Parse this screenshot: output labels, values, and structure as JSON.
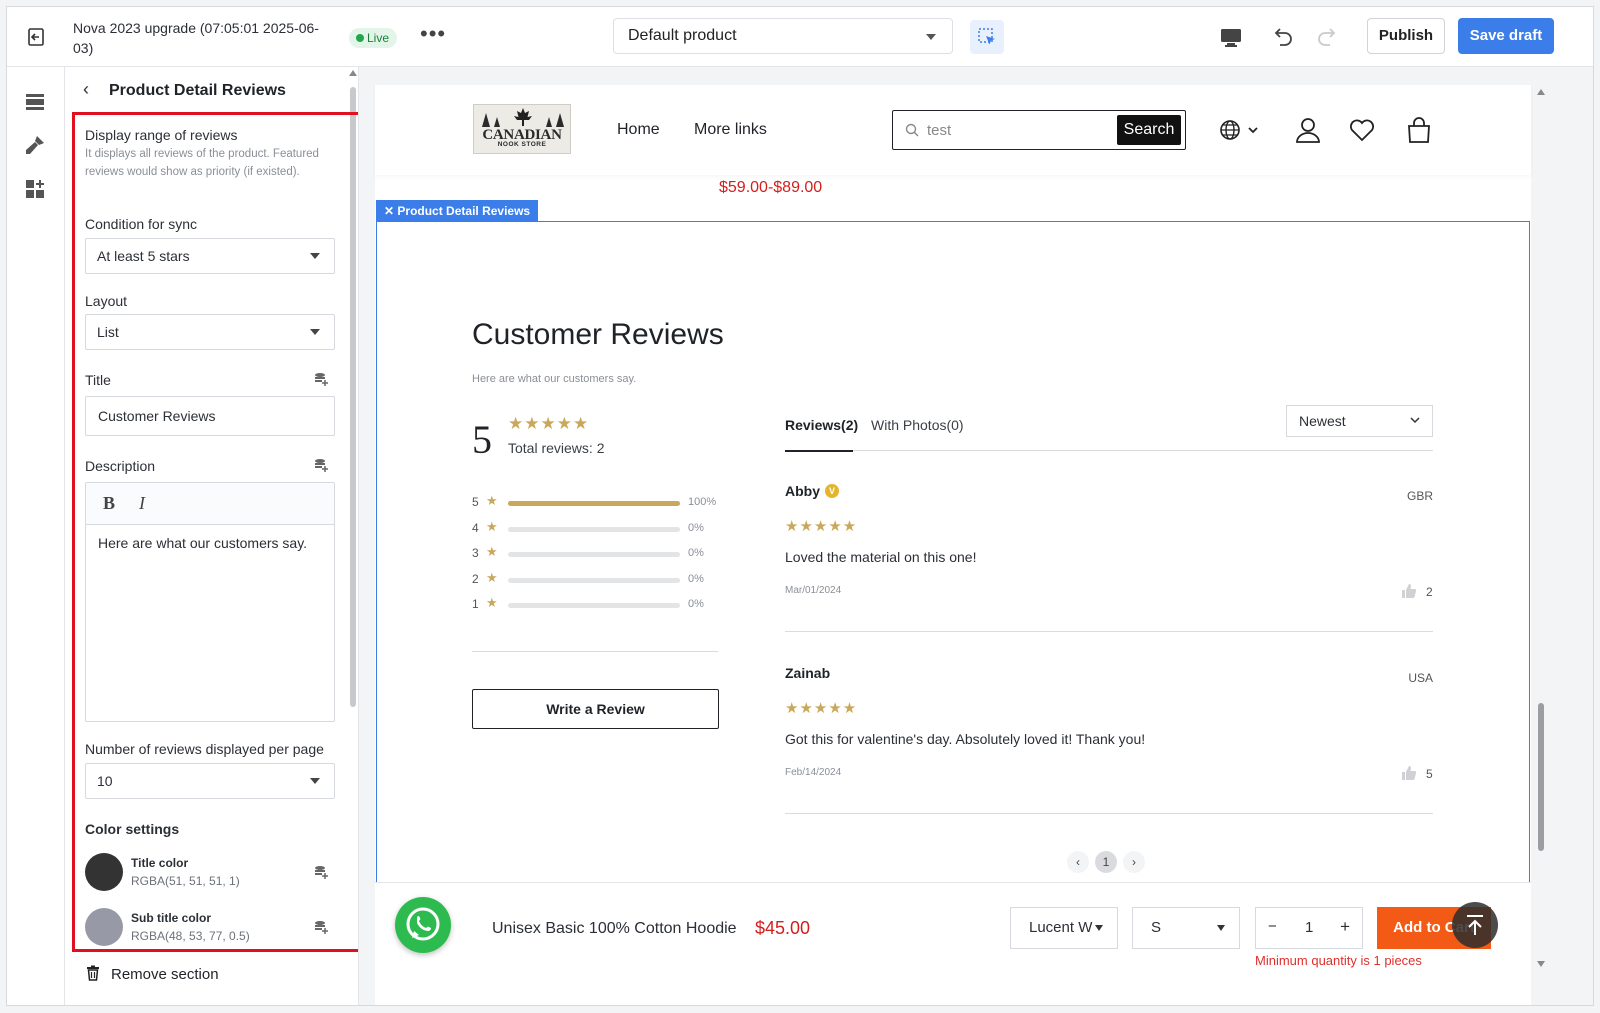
{
  "topbar": {
    "title": "Nova 2023 upgrade (07:05:01 2025-06-03)",
    "status": "Live",
    "more": "•••",
    "product_select": "Default product",
    "publish": "Publish",
    "save_draft": "Save draft",
    "accent_color": "#3b7de9"
  },
  "panel": {
    "heading": "Product Detail Reviews",
    "display_range": {
      "label": "Display range of reviews",
      "help": "It displays all reviews of the product. Featured reviews would show as priority (if existed)."
    },
    "condition": {
      "label": "Condition for sync",
      "value": "At least 5 stars"
    },
    "layout": {
      "label": "Layout",
      "value": "List"
    },
    "title": {
      "label": "Title",
      "value": "Customer Reviews"
    },
    "description": {
      "label": "Description",
      "value": "Here are what our customers say."
    },
    "per_page": {
      "label": "Number of reviews displayed per page",
      "value": "10"
    },
    "color_settings": {
      "label": "Color settings",
      "items": [
        {
          "name": "Title color",
          "value": "RGBA(51, 51, 51, 1)",
          "color": "#333333"
        },
        {
          "name": "Sub title color",
          "value": "RGBA(48, 53, 77, 0.5)",
          "color": "#9799a6"
        }
      ]
    },
    "remove": "Remove section",
    "highlight_color": "#e0101e"
  },
  "store": {
    "logo_line1": "CANADIAN",
    "logo_line2": "NOOK STORE",
    "nav": [
      "Home",
      "More links"
    ],
    "search_value": "test",
    "search_button": "Search",
    "price_range": "$59.00-$89.00"
  },
  "section_tag": "Product Detail Reviews",
  "reviews": {
    "title": "Customer Reviews",
    "subtitle": "Here are what our customers say.",
    "average": "5",
    "stars": "★★★★★",
    "total": "Total reviews: 2",
    "distribution": [
      {
        "star": "5",
        "pct": "100%",
        "fraction": 1.0
      },
      {
        "star": "4",
        "pct": "0%",
        "fraction": 0
      },
      {
        "star": "3",
        "pct": "0%",
        "fraction": 0
      },
      {
        "star": "2",
        "pct": "0%",
        "fraction": 0
      },
      {
        "star": "1",
        "pct": "0%",
        "fraction": 0
      }
    ],
    "write_review": "Write a Review",
    "tabs": [
      "Reviews(2)",
      "With Photos(0)"
    ],
    "sort": "Newest",
    "items": [
      {
        "name": "Abby",
        "verified": "V",
        "country": "GBR",
        "stars": "★★★★★",
        "text": "Loved the material on this one!",
        "date": "Mar/01/2024",
        "likes": "2"
      },
      {
        "name": "Zainab",
        "country": "USA",
        "stars": "★★★★★",
        "text": "Got this for valentine's day. Absolutely loved it! Thank you!",
        "date": "Feb/14/2024",
        "likes": "5"
      }
    ],
    "pager": {
      "prev": "‹",
      "current": "1",
      "next": "›"
    },
    "star_color": "#c9a85c"
  },
  "sticky": {
    "product": "Unisex Basic 100% Cotton Hoodie",
    "price": "$45.00",
    "color_option": "Lucent W",
    "size_option": "S",
    "qty_minus": "−",
    "qty": "1",
    "qty_plus": "+",
    "add_to_cart": "Add to Cart",
    "min_qty": "Minimum quantity is 1 pieces"
  }
}
